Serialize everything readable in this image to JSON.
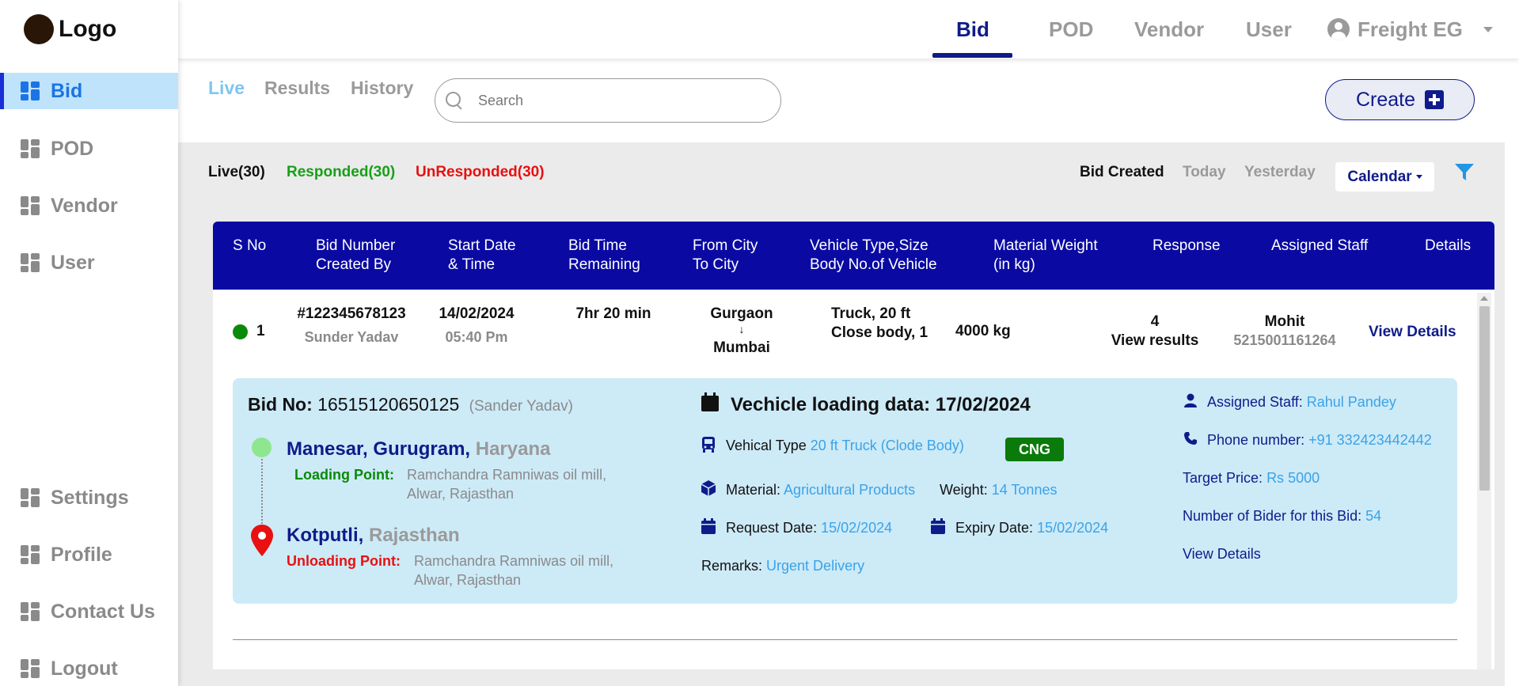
{
  "brand": {
    "logo_text": "Logo"
  },
  "sidebar": {
    "items": [
      {
        "label": "Bid",
        "icon": "dashboard-icon",
        "active": true
      },
      {
        "label": "POD",
        "icon": "dashboard-icon"
      },
      {
        "label": "Vendor",
        "icon": "dashboard-icon"
      },
      {
        "label": "User",
        "icon": "dashboard-icon"
      },
      {
        "label": "Settings",
        "icon": "dashboard-icon"
      },
      {
        "label": "Profile",
        "icon": "dashboard-icon"
      },
      {
        "label": "Contact Us",
        "icon": "dashboard-icon"
      },
      {
        "label": "Logout",
        "icon": "dashboard-icon"
      }
    ]
  },
  "topnav": {
    "items": [
      "Bid",
      "POD",
      "Vendor",
      "User"
    ],
    "active": "Bid",
    "user_label": "Freight EG"
  },
  "subtabs": {
    "live": "Live",
    "results": "Results",
    "history": "History",
    "active": "Live"
  },
  "search": {
    "placeholder": "Search",
    "value": ""
  },
  "create": {
    "label": "Create"
  },
  "stats": {
    "live": "Live(30)",
    "responded": "Responded(30)",
    "unresponded": "UnResponded(30)"
  },
  "filters": {
    "bid_created": "Bid Created",
    "today": "Today",
    "yesterday": "Yesterday",
    "calendar": "Calendar"
  },
  "table": {
    "headers": [
      {
        "l1": "S No",
        "l2": ""
      },
      {
        "l1": "Bid Number",
        "l2": "Created By"
      },
      {
        "l1": "Start Date",
        "l2": "& Time"
      },
      {
        "l1": "Bid Time",
        "l2": "Remaining"
      },
      {
        "l1": "From City",
        "l2": "To City"
      },
      {
        "l1": "Vehicle Type,Size",
        "l2": "Body No.of Vehicle"
      },
      {
        "l1": "Material Weight",
        "l2": "(in kg)"
      },
      {
        "l1": "Response",
        "l2": ""
      },
      {
        "l1": "Assigned Staff",
        "l2": ""
      },
      {
        "l1": "Details",
        "l2": ""
      }
    ],
    "row": {
      "s_no": "1",
      "bid_number": "#122345678123",
      "created_by": "Sunder Yadav",
      "start_date": "14/02/2024",
      "start_time": "05:40 Pm",
      "time_remaining": "7hr 20 min",
      "from_city": "Gurgaon",
      "arrow": "↓",
      "to_city": "Mumbai",
      "vehicle_line1": "Truck, 20 ft",
      "vehicle_line2": "Close body, 1",
      "weight": "4000 kg",
      "response_count": "4",
      "response_link": "View results",
      "staff_name": "Mohit",
      "staff_phone": "5215001161264",
      "details_link": "View Details"
    }
  },
  "detail": {
    "bid_no_label": "Bid No:",
    "bid_no": "16515120650125",
    "bid_creator": "(Sander Yadav)",
    "loading_city": "Manesar, Gurugram,",
    "loading_state": "Haryana",
    "loading_point_label": "Loading Point:",
    "loading_point_l1": "Ramchandra Ramniwas oil mill,",
    "loading_point_l2": "Alwar, Rajasthan",
    "unloading_city": "Kotputli,",
    "unloading_state": "Rajasthan",
    "unloading_point_label": "Unloading Point:",
    "unloading_point_l1": "Ramchandra Ramniwas oil mill,",
    "unloading_point_l2": "Alwar, Rajasthan",
    "loading_date_title": "Vechicle loading data: 17/02/2024",
    "vehicle_type_label": "Vehical Type",
    "vehicle_type": "20 ft Truck (Clode Body)",
    "fuel_badge": "CNG",
    "material_label": "Material:",
    "material": "Agricultural Products",
    "weight_label": "Weight:",
    "weight": "14 Tonnes",
    "request_date_label": "Request Date:",
    "request_date": "15/02/2024",
    "expiry_date_label": "Expiry Date:",
    "expiry_date": "15/02/2024",
    "remarks_label": "Remarks:",
    "remarks": "Urgent Delivery",
    "assigned_staff_label": "Assigned Staff:",
    "assigned_staff": "Rahul Pandey",
    "phone_label": "Phone number:",
    "phone": "+91 332423442442",
    "target_price_label": "Target Price:",
    "target_price": "Rs 5000",
    "bidders_label": "Number of Bider for this Bid:",
    "bidders": "54",
    "view_details": "View Details"
  },
  "colors": {
    "primary_navy": "#0f1b8a",
    "table_header": "#0a0aa3",
    "accent_blue": "#3aa3e8",
    "responded_green": "#16a016",
    "unresponded_red": "#e81010",
    "detail_bg": "#cdeaf7"
  }
}
